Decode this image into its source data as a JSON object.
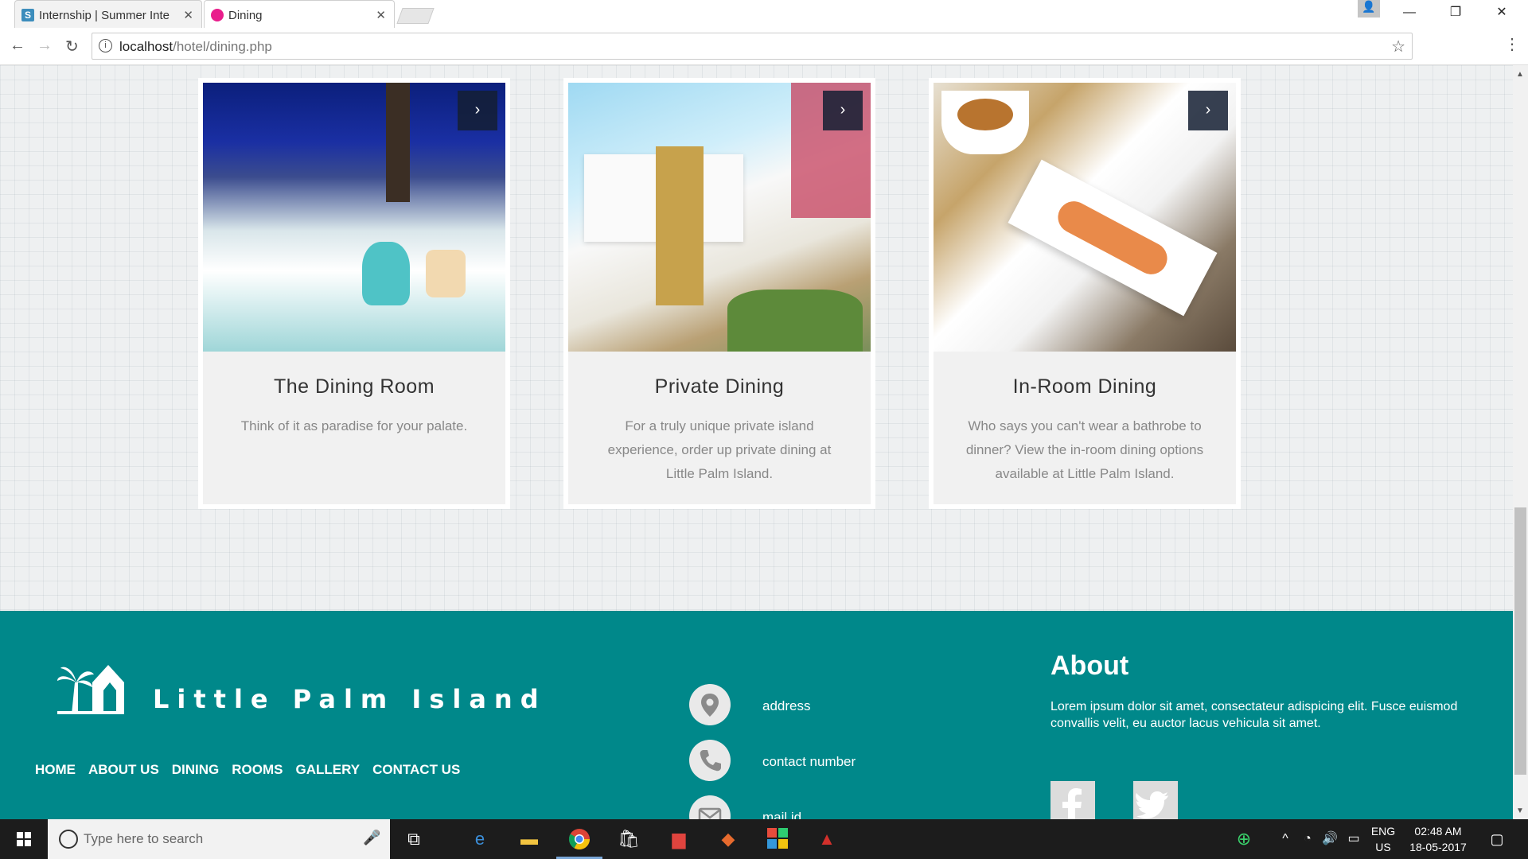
{
  "browser": {
    "tabs": [
      {
        "label": "Internship | Summer Inte",
        "favicon": "S",
        "active": false
      },
      {
        "label": "Dining",
        "active": true
      }
    ],
    "url_host": "localhost",
    "url_path": "/hotel/dining.php"
  },
  "cards": [
    {
      "title": "The Dining Room",
      "description": "Think of it as paradise for your palate.",
      "arrow": "›"
    },
    {
      "title": "Private Dining",
      "description": "For a truly unique private island experience, order up private dining at Little Palm Island.",
      "arrow": "›"
    },
    {
      "title": "In-Room Dining",
      "description": "Who says you can't wear a bathrobe to dinner? View the in-room dining options available at Little Palm Island.",
      "arrow": "›"
    }
  ],
  "footer": {
    "brand": "Little Palm Island",
    "nav": [
      "HOME",
      "ABOUT US",
      "DINING",
      "ROOMS",
      "GALLERY",
      "CONTACT US"
    ],
    "contacts": [
      {
        "label": "address",
        "icon": "map-pin-icon"
      },
      {
        "label": "contact number",
        "icon": "phone-icon"
      },
      {
        "label": "mail id",
        "icon": "mail-icon"
      }
    ],
    "about_title": "About",
    "about_text": "Lorem ipsum dolor sit amet, consectateur adispicing elit. Fusce euismod convallis velit, eu auctor lacus vehicula sit amet.",
    "accent_color": "#00888a"
  },
  "taskbar": {
    "search_placeholder": "Type here to search",
    "lang_top": "ENG",
    "lang_bottom": "US",
    "time": "02:48 AM",
    "date": "18-05-2017"
  }
}
